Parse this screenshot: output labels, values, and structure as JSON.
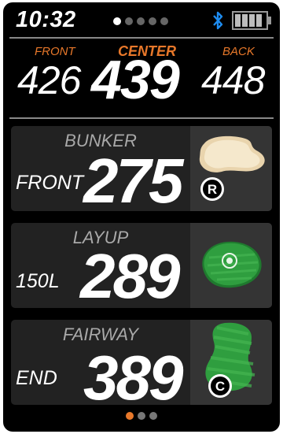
{
  "status": {
    "time": "10:32",
    "page_dots": 5,
    "active_dot": 0,
    "bluetooth_icon": "bluetooth-icon",
    "battery_icon": "battery-icon"
  },
  "distances": {
    "front_label": "FRONT",
    "center_label": "CENTER",
    "back_label": "BACK",
    "front": "426",
    "center": "439",
    "back": "448"
  },
  "hazards": [
    {
      "name": "BUNKER",
      "side": "FRONT",
      "distance": "275",
      "image": "bunker-icon",
      "marker": "R"
    },
    {
      "name": "LAYUP",
      "side": "150L",
      "distance": "289",
      "image": "green-target-icon"
    },
    {
      "name": "FAIRWAY",
      "side": "END",
      "distance": "389",
      "image": "fairway-icon",
      "marker": "C"
    }
  ],
  "pager": {
    "count": 3,
    "active": 0
  },
  "colors": {
    "accent": "#e8782a",
    "bluetooth": "#1e8cf0",
    "green": "#2e9e3e"
  }
}
